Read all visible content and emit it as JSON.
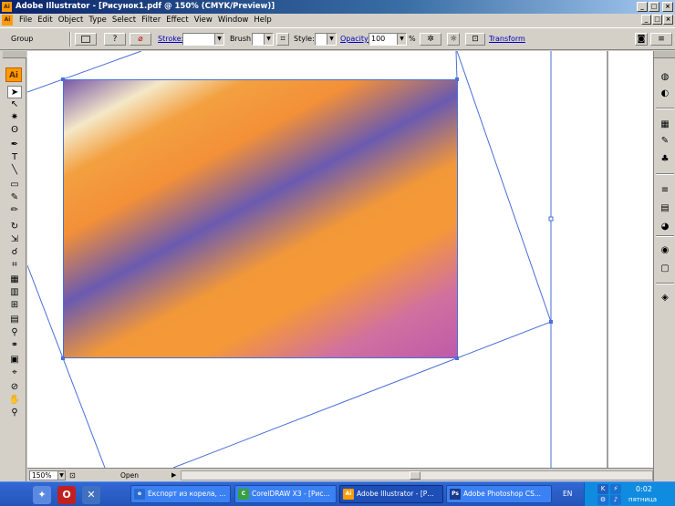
{
  "window": {
    "app_icon": "Ai",
    "title": "Adobe Illustrator - [Рисунок1.pdf @ 150% (CMYK/Preview)]",
    "controls": [
      "_",
      "□",
      "×"
    ]
  },
  "menubar": {
    "doc_icon": "Ai",
    "items": [
      "File",
      "Edit",
      "Object",
      "Type",
      "Select",
      "Filter",
      "Effect",
      "View",
      "Window",
      "Help"
    ],
    "doc_controls": [
      "_",
      "□",
      "×"
    ]
  },
  "controlbar": {
    "selection_label": "Group",
    "stroke_label": "Stroke:",
    "brush_label": "Brush:",
    "style_label": "Style:",
    "opacity_label": "Opacity:",
    "opacity_value": "100",
    "opacity_unit": "%",
    "transform_label": "Transform",
    "fill_glyph": "?",
    "stroke_glyph": "⌀"
  },
  "toolbox": {
    "badge": "Ai",
    "tools": [
      {
        "name": "selection-tool-icon",
        "glyph": "➤"
      },
      {
        "name": "direct-selection-tool-icon",
        "glyph": "↖"
      },
      {
        "name": "magic-wand-tool-icon",
        "glyph": "✷"
      },
      {
        "name": "lasso-tool-icon",
        "glyph": "ʘ"
      },
      {
        "name": "pen-tool-icon",
        "glyph": "✒"
      },
      {
        "name": "type-tool-icon",
        "glyph": "T"
      },
      {
        "name": "line-tool-icon",
        "glyph": "╲"
      },
      {
        "name": "rectangle-tool-icon",
        "glyph": "▭"
      },
      {
        "name": "paintbrush-tool-icon",
        "glyph": "✎"
      },
      {
        "name": "pencil-tool-icon",
        "glyph": "✏"
      },
      {
        "name": "rotate-tool-icon",
        "glyph": "↻"
      },
      {
        "name": "scale-tool-icon",
        "glyph": "⇲"
      },
      {
        "name": "warp-tool-icon",
        "glyph": "☌"
      },
      {
        "name": "free-transform-tool-icon",
        "glyph": "⌗"
      },
      {
        "name": "symbol-sprayer-tool-icon",
        "glyph": "▦"
      },
      {
        "name": "column-graph-tool-icon",
        "glyph": "▥"
      },
      {
        "name": "mesh-tool-icon",
        "glyph": "⊞"
      },
      {
        "name": "gradient-tool-icon",
        "glyph": "▤"
      },
      {
        "name": "eyedropper-tool-icon",
        "glyph": "⚲"
      },
      {
        "name": "blend-tool-icon",
        "glyph": "⚭"
      },
      {
        "name": "live-paint-tool-icon",
        "glyph": "▣"
      },
      {
        "name": "crop-area-tool-icon",
        "glyph": "⌖"
      },
      {
        "name": "slice-tool-icon",
        "glyph": "⊘"
      },
      {
        "name": "hand-tool-icon",
        "glyph": "✋"
      },
      {
        "name": "zoom-tool-icon",
        "glyph": "⚲"
      }
    ]
  },
  "rightdock": {
    "icons": [
      {
        "name": "color-guide-panel-icon",
        "glyph": "◍"
      },
      {
        "name": "color-panel-icon",
        "glyph": "◐"
      },
      {
        "name": "swatches-panel-icon",
        "glyph": "▦"
      },
      {
        "name": "brushes-panel-icon",
        "glyph": "✎"
      },
      {
        "name": "symbols-panel-icon",
        "glyph": "♣"
      },
      {
        "name": "stroke-panel-icon",
        "glyph": "≡"
      },
      {
        "name": "gradient-panel-icon",
        "glyph": "▤"
      },
      {
        "name": "transparency-panel-icon",
        "glyph": "◕"
      },
      {
        "name": "appearance-panel-icon",
        "glyph": "◉"
      },
      {
        "name": "graphic-styles-panel-icon",
        "glyph": "▢"
      },
      {
        "name": "layers-panel-icon",
        "glyph": "◈"
      }
    ]
  },
  "statusbar": {
    "zoom": "150%",
    "status": "Open"
  },
  "taskbar": {
    "tasks": [
      {
        "label": "Експорт из корела, ...",
        "icon": "e"
      },
      {
        "label": "CorelDRAW X3 - [Рис...",
        "icon": "C"
      },
      {
        "label": "Adobe Illustrator - [Р...",
        "icon": "Ai",
        "active": true
      },
      {
        "label": "Adobe Photoshop CS...",
        "icon": "Ps"
      }
    ],
    "language": "EN",
    "time": "0:02",
    "day": "пятница"
  },
  "colors": {
    "selection": "#4a6ed8",
    "title_gradient_start": "#0a246a",
    "taskbar": "#2454b8",
    "ai_orange": "#ff9a00"
  }
}
